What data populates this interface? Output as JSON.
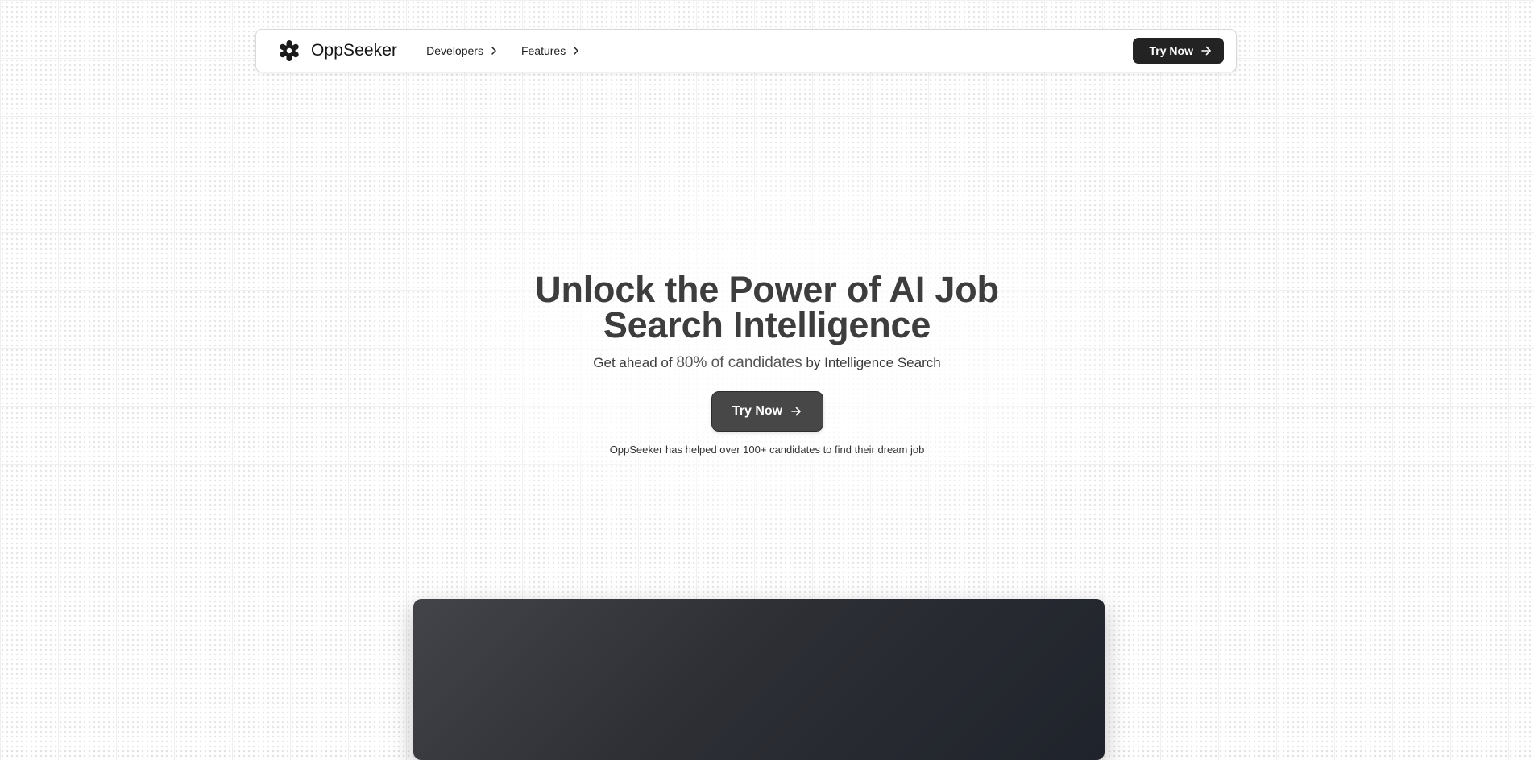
{
  "nav": {
    "brand": "OppSeeker",
    "links": [
      {
        "label": "Developers"
      },
      {
        "label": "Features"
      }
    ],
    "cta_label": "Try Now"
  },
  "hero": {
    "title": "Unlock the Power of AI Job Search Intelligence",
    "subtitle_prefix": "Get ahead of",
    "subtitle_highlight": "80% of candidates",
    "subtitle_suffix": "by Intelligence Search",
    "cta_label": "Try Now",
    "note": "OppSeeker has helped over 100+ candidates to find their dream job"
  },
  "icons": {
    "logo": "asterisk-logo-icon",
    "chevron": "chevron-right-icon",
    "arrow": "arrow-right-icon"
  },
  "colors": {
    "primary_dark": "#232323",
    "hero_button": "#474747",
    "title_text": "#3d3d3d",
    "preview_panel": "#2d2f35"
  }
}
